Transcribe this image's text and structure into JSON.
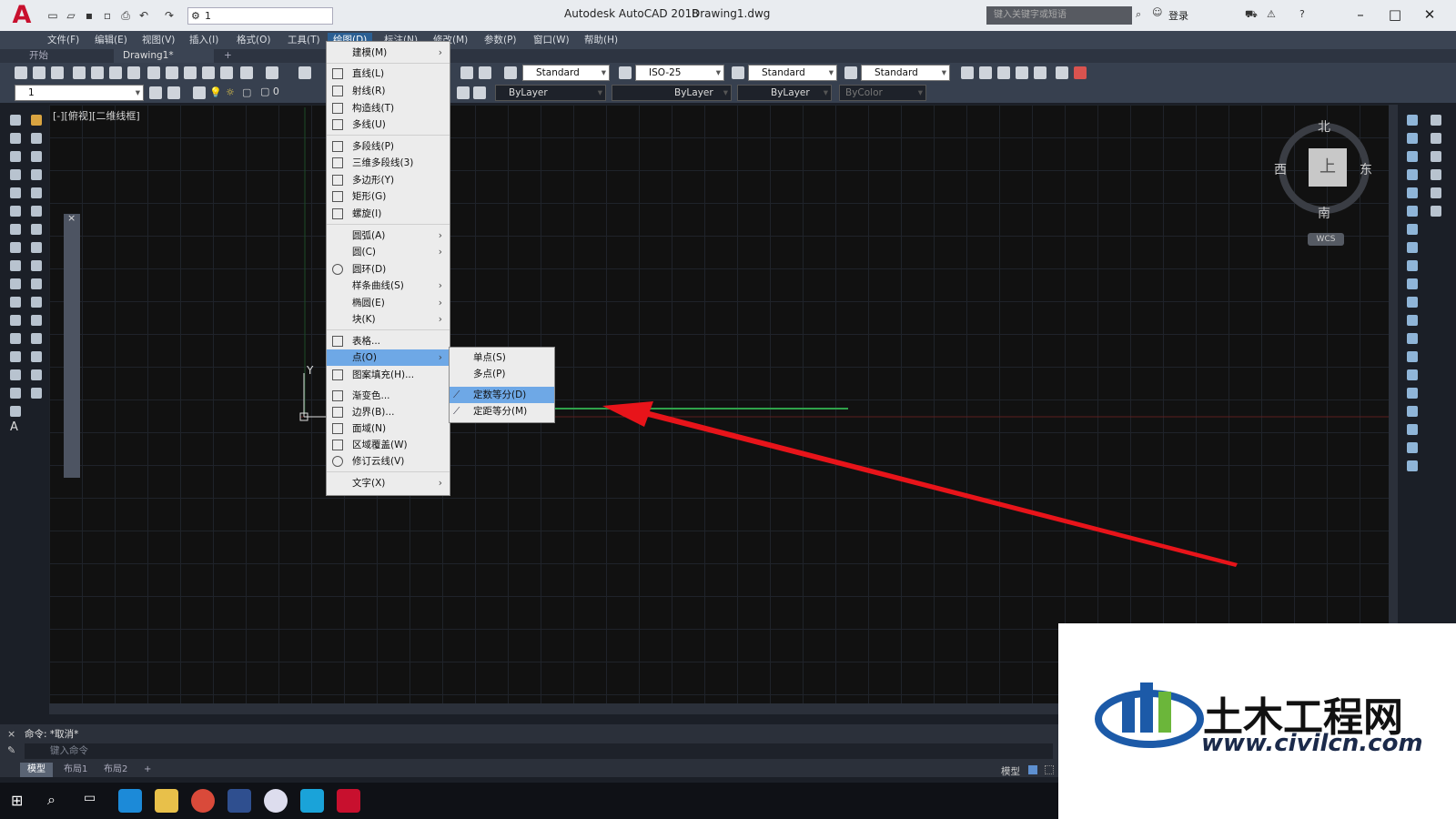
{
  "window": {
    "app_title": "Autodesk AutoCAD 2018",
    "doc_title": "Drawing1.dwg",
    "workspace": "1",
    "search_placeholder": "键入关键字或短语",
    "login": "登录"
  },
  "menubar": [
    "文件(F)",
    "编辑(E)",
    "视图(V)",
    "插入(I)",
    "格式(O)",
    "工具(T)",
    "绘图(D)",
    "标注(N)",
    "修改(M)",
    "参数(P)",
    "窗口(W)",
    "帮助(H)"
  ],
  "tabs": {
    "start": "开始",
    "drawing": "Drawing1*",
    "add": "+"
  },
  "toolbar": {
    "text_style": "Standard",
    "dim_style": "ISO-25",
    "table_style": "Standard",
    "multileader_style": "Standard",
    "layer": "1",
    "layer_state": "0",
    "color": "ByLayer",
    "linetype": "ByLayer",
    "lineweight": "ByLayer",
    "plotstyle": "ByColor"
  },
  "viewport": {
    "label": "[-][俯视][二维线框]",
    "ucs_y": "Y"
  },
  "viewcube": {
    "north": "北",
    "south": "南",
    "east": "东",
    "west": "西",
    "top": "上",
    "wcs": "WCS"
  },
  "draw_menu": {
    "items": [
      {
        "label": "建模(M)",
        "sub": true
      },
      {
        "label": "直线(L)",
        "sub": false
      },
      {
        "label": "射线(R)",
        "sub": false
      },
      {
        "label": "构造线(T)",
        "sub": false
      },
      {
        "label": "多线(U)",
        "sub": false
      },
      {
        "label": "多段线(P)",
        "sub": false
      },
      {
        "label": "三维多段线(3)",
        "sub": false
      },
      {
        "label": "多边形(Y)",
        "sub": false
      },
      {
        "label": "矩形(G)",
        "sub": false
      },
      {
        "label": "螺旋(I)",
        "sub": false
      },
      {
        "label": "圆弧(A)",
        "sub": true
      },
      {
        "label": "圆(C)",
        "sub": true
      },
      {
        "label": "圆环(D)",
        "sub": false
      },
      {
        "label": "样条曲线(S)",
        "sub": true
      },
      {
        "label": "椭圆(E)",
        "sub": true
      },
      {
        "label": "块(K)",
        "sub": true
      },
      {
        "label": "表格...",
        "sub": false
      },
      {
        "label": "点(O)",
        "sub": true
      },
      {
        "label": "图案填充(H)...",
        "sub": false
      },
      {
        "label": "渐变色...",
        "sub": false
      },
      {
        "label": "边界(B)...",
        "sub": false
      },
      {
        "label": "面域(N)",
        "sub": false
      },
      {
        "label": "区域覆盖(W)",
        "sub": false
      },
      {
        "label": "修订云线(V)",
        "sub": false
      },
      {
        "label": "文字(X)",
        "sub": true
      }
    ]
  },
  "point_menu": {
    "items": [
      "单点(S)",
      "多点(P)",
      "定数等分(D)",
      "定距等分(M)"
    ],
    "highlighted": 2
  },
  "command": {
    "history": "命令: *取消*",
    "placeholder": "键入命令"
  },
  "layout_tabs": [
    "模型",
    "布局1",
    "布局2",
    "+"
  ],
  "status": {
    "model": "模型"
  },
  "watermark": {
    "name": "土木工程网",
    "url": "www.civilcn.com"
  },
  "colors": {
    "accent": "#c8102e",
    "menu_highlight": "#6ea8e6",
    "arrow": "#e8141a",
    "ucs_green": "#2fa24a",
    "ucs_red": "#b22a2a"
  }
}
